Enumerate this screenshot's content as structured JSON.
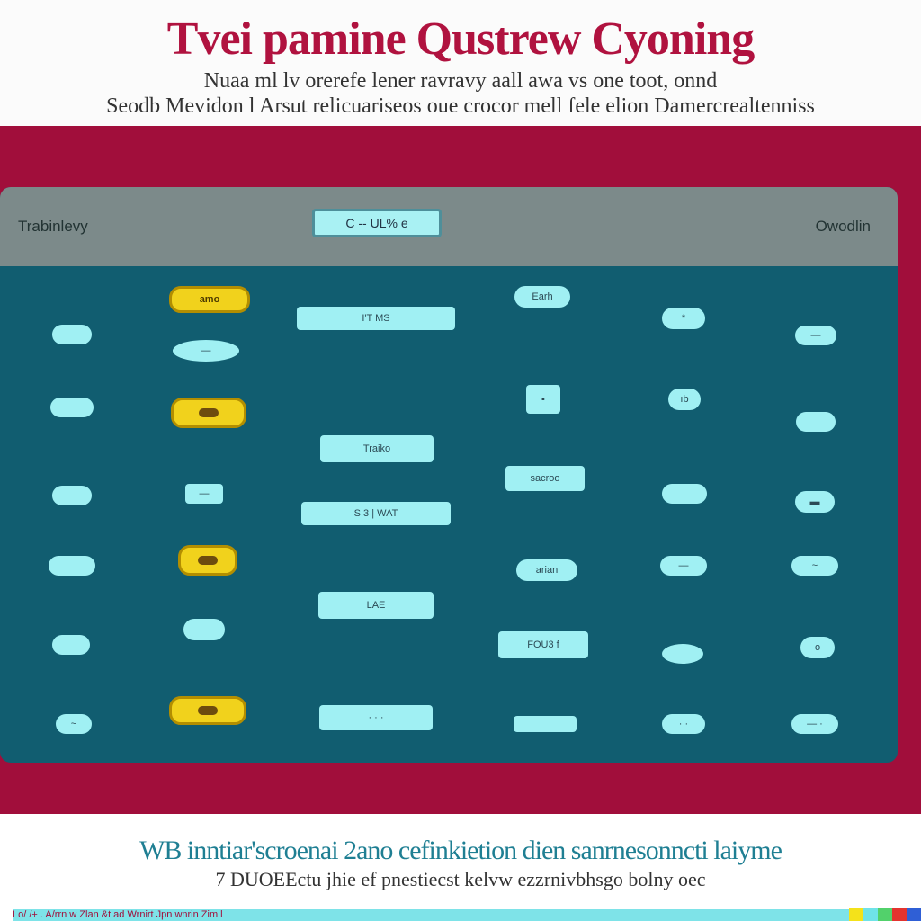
{
  "header": {
    "title": "Tvei pamine Qustrew Cyoning",
    "subtitle_1": "Nuaa ml lv orerefe lener ravravy aall awa vs one toot, onnd",
    "subtitle_2": "Seodb Mevidon l Arsut relicuariseos oue crocor mell fele elion Damercrealtenniss"
  },
  "toolbar": {
    "left_label": "Trabinlevy",
    "search_value": "C -- UL% e",
    "right_label": "Owodlin"
  },
  "grid": {
    "items": [
      {
        "id": "chip-1",
        "label": "amo",
        "style": "yellow",
        "interactable": true
      },
      {
        "id": "chip-2",
        "label": "Earh",
        "style": "pill",
        "interactable": true
      },
      {
        "id": "chip-3",
        "label": "I'T  MS",
        "style": "rect",
        "interactable": true
      },
      {
        "id": "chip-4",
        "label": "",
        "style": "pill",
        "interactable": true
      },
      {
        "id": "chip-5",
        "label": "—",
        "style": "lens",
        "interactable": true
      },
      {
        "id": "chip-6",
        "label": "*",
        "style": "pill",
        "interactable": true
      },
      {
        "id": "chip-7",
        "label": "—",
        "style": "pill",
        "interactable": true
      },
      {
        "id": "chip-8",
        "label": "",
        "style": "pill",
        "interactable": true
      },
      {
        "id": "chip-9",
        "label": "",
        "style": "yellow",
        "interactable": true
      },
      {
        "id": "chip-10",
        "label": "▪",
        "style": "square",
        "interactable": true
      },
      {
        "id": "chip-11",
        "label": "ıb",
        "style": "pill",
        "interactable": true
      },
      {
        "id": "chip-12",
        "label": "",
        "style": "pill",
        "interactable": true
      },
      {
        "id": "chip-13",
        "label": "Traiko",
        "style": "rect",
        "interactable": true
      },
      {
        "id": "chip-14",
        "label": "sacroo",
        "style": "rect",
        "interactable": true
      },
      {
        "id": "chip-15",
        "label": "",
        "style": "pill",
        "interactable": true
      },
      {
        "id": "chip-16",
        "label": "—",
        "style": "rect",
        "interactable": true
      },
      {
        "id": "chip-17",
        "label": "S 3 | WAT",
        "style": "rect",
        "interactable": true
      },
      {
        "id": "chip-18",
        "label": "",
        "style": "pill",
        "interactable": true
      },
      {
        "id": "chip-19",
        "label": "▬",
        "style": "pill",
        "interactable": true
      },
      {
        "id": "chip-20",
        "label": "",
        "style": "pill",
        "interactable": true
      },
      {
        "id": "chip-21",
        "label": "",
        "style": "yellow",
        "interactable": true
      },
      {
        "id": "chip-22",
        "label": "arian",
        "style": "pill",
        "interactable": true
      },
      {
        "id": "chip-23",
        "label": "—",
        "style": "pill",
        "interactable": true
      },
      {
        "id": "chip-24",
        "label": "~",
        "style": "pill",
        "interactable": true
      },
      {
        "id": "chip-25",
        "label": "",
        "style": "pill",
        "interactable": true
      },
      {
        "id": "chip-26",
        "label": "LAE",
        "style": "rect",
        "interactable": true
      },
      {
        "id": "chip-27",
        "label": "",
        "style": "pill",
        "interactable": true
      },
      {
        "id": "chip-28",
        "label": "FOU3 f",
        "style": "rect",
        "interactable": true
      },
      {
        "id": "chip-29",
        "label": "",
        "style": "lens",
        "interactable": true
      },
      {
        "id": "chip-30",
        "label": "o",
        "style": "pill",
        "interactable": true
      },
      {
        "id": "chip-31",
        "label": "~",
        "style": "pill",
        "interactable": true
      },
      {
        "id": "chip-32",
        "label": "",
        "style": "yellow",
        "interactable": true
      },
      {
        "id": "chip-33",
        "label": "· · ·",
        "style": "rect",
        "interactable": true
      },
      {
        "id": "chip-34",
        "label": "",
        "style": "rect",
        "interactable": true
      },
      {
        "id": "chip-35",
        "label": "· ·",
        "style": "pill",
        "interactable": true
      },
      {
        "id": "chip-36",
        "label": "— ·",
        "style": "pill",
        "interactable": true
      }
    ]
  },
  "footer": {
    "line_1": "WB inntiar'scroenai 2ano cefinkietion dien sanrnesonncti laiyme",
    "line_2": "7 DUOEEctu jhie ef pnestiecst kelvw ezzrnivbhsgo bolny oec",
    "strip_text": "Lo/ /+ . A/rrn w Zlan &t  ad Wrnirt Jpn wnrin Zim l"
  },
  "colors": {
    "brand_red": "#a10e3b",
    "panel_teal": "#115d70",
    "chip_cyan": "#a0f0f3",
    "accent_yellow": "#f1d21c",
    "toolbar_grey": "#7c8a8a"
  }
}
